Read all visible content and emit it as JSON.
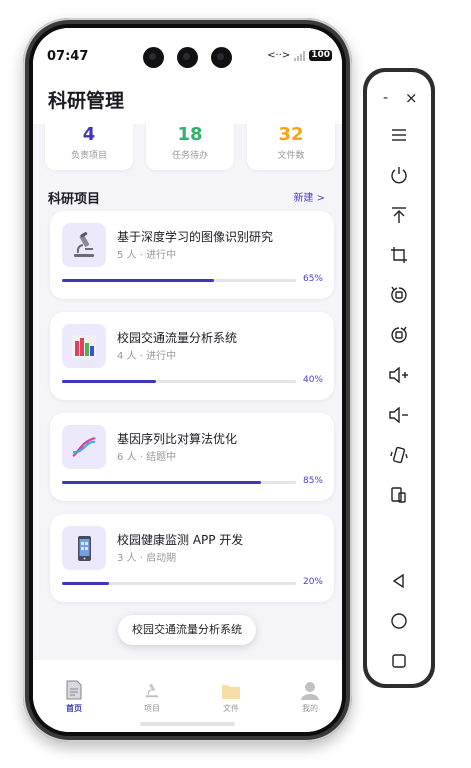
{
  "status_bar": {
    "time": "07:47",
    "network": "<··>",
    "battery": "100"
  },
  "header": {
    "title": "科研管理"
  },
  "stats": [
    {
      "value": "4",
      "label": "负责项目",
      "color": "#4136b8"
    },
    {
      "value": "18",
      "label": "任务待办",
      "color": "#2fb36b"
    },
    {
      "value": "32",
      "label": "文件数",
      "color": "#f2a516"
    }
  ],
  "section": {
    "title": "科研项目",
    "link": "新建 >"
  },
  "projects": [
    {
      "title": "基于深度学习的图像识别研究",
      "meta": "5 人 · 进行中",
      "percent_label": "65%",
      "progress": 0.65,
      "icon": "microscope-icon"
    },
    {
      "title": "校园交通流量分析系统",
      "meta": "4 人 · 进行中",
      "percent_label": "40%",
      "progress": 0.4,
      "icon": "bar-chart-icon"
    },
    {
      "title": "基因序列比对算法优化",
      "meta": "6 人 · 结题中",
      "percent_label": "85%",
      "progress": 0.85,
      "icon": "dna-icon"
    },
    {
      "title": "校园健康监测 APP 开发",
      "meta": "3 人 · 启动期",
      "percent_label": "20%",
      "progress": 0.2,
      "icon": "phone-icon"
    }
  ],
  "toast": {
    "text": "校园交通流量分析系统"
  },
  "tabbar": [
    {
      "label": "首页",
      "icon": "document-icon",
      "active": true
    },
    {
      "label": "项目",
      "icon": "microscope-icon",
      "active": false
    },
    {
      "label": "文件",
      "icon": "folder-icon",
      "active": false
    },
    {
      "label": "我的",
      "icon": "user-icon",
      "active": false
    }
  ],
  "emulator_sidebar": {
    "top_controls": {
      "minimize": "-",
      "close": "×"
    },
    "buttons": [
      "menu-icon",
      "power-icon",
      "rotate-to-top-icon",
      "crop-icon",
      "rotate-left-icon",
      "rotate-right-icon",
      "volume-up-icon",
      "volume-down-icon",
      "shake-icon",
      "fold-icon",
      "back-icon",
      "home-icon",
      "overview-icon"
    ]
  }
}
